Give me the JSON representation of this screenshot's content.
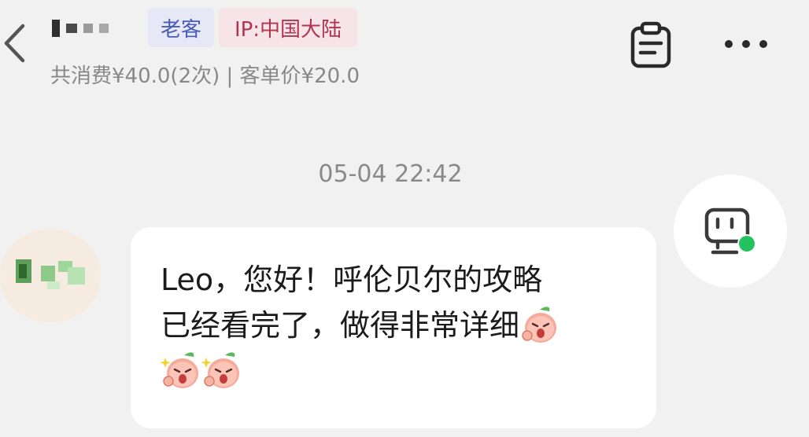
{
  "header": {
    "back_icon": "chevron-left-icon",
    "tags": {
      "regular": "老客",
      "ip": "IP:中国大陆"
    },
    "consumption": "共消费¥40.0(2次) | 客单价¥20.0",
    "clipboard_icon": "clipboard-icon",
    "more_icon": "more-icon"
  },
  "chat": {
    "timestamp": "05-04 22:42",
    "message": {
      "line1": "Leo，您好！呼伦贝尔的攻略",
      "line2": "已经看完了，做得非常详细",
      "stickers": [
        "peach-cheer-sticker",
        "peach-cheer-sticker",
        "peach-cheer-sticker"
      ]
    }
  },
  "floating": {
    "icon": "customer-service-icon",
    "status_color": "#22c35e"
  },
  "colors": {
    "background": "#f1f1f1",
    "tag_regular_bg": "#e6e8f6",
    "tag_regular_text": "#4a5bb8",
    "tag_ip_bg": "#f6e4e8",
    "tag_ip_text": "#b0354f"
  }
}
